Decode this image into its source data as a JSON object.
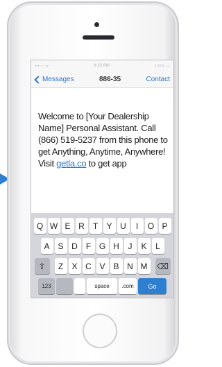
{
  "status": {
    "time": "9:25 PM",
    "battery": "100%"
  },
  "navbar": {
    "back_label": "Messages",
    "title": "886-35",
    "contact_label": "Contact"
  },
  "message": {
    "text_before": "Welcome to [Your Dealership Name] Personal Assistant. Call (866) 519-5237 from this phone to get Anything, Anytime, Anywhere! Visit",
    "link": "getla.co",
    "text_after": "to get app"
  },
  "keyboard": {
    "row1": [
      "Q",
      "W",
      "E",
      "R",
      "T",
      "Y",
      "U",
      "I",
      "O",
      "P"
    ],
    "row2": [
      "A",
      "S",
      "D",
      "F",
      "G",
      "H",
      "J",
      "K",
      "L"
    ],
    "row3": [
      "Z",
      "X",
      "C",
      "V",
      "B",
      "N",
      "M"
    ],
    "numbers_label": "123",
    "space_label": "space",
    "dotcom_label": ".com",
    "go_label": "Go",
    "shift_icon": "shift-icon",
    "delete_icon": "backspace-icon"
  },
  "colors": {
    "accent": "#2f7fd1",
    "keyboard_bg": "#d4d6db"
  }
}
